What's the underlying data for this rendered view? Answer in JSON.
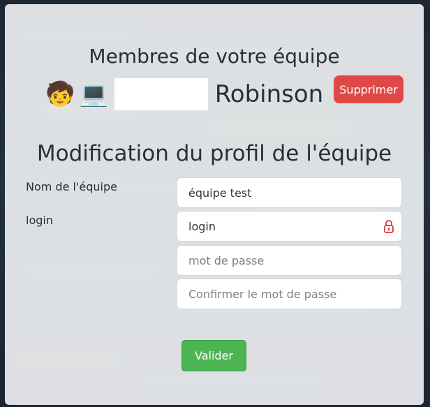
{
  "members_section": {
    "title": "Membres de votre équipe",
    "member": {
      "avatar_emoji": "🧒",
      "device_emoji": "💻",
      "last_name": "Robinson",
      "delete_label": "Supprimer"
    }
  },
  "profile_section": {
    "title": "Modification du profil de l'équipe",
    "team_name": {
      "label": "Nom de l'équipe",
      "value": "équipe test"
    },
    "login": {
      "label": "login",
      "value": "login"
    },
    "password": {
      "placeholder": "mot de passe"
    },
    "confirm_password": {
      "placeholder": "Confirmer le mot de passe"
    },
    "submit_label": "Valider"
  },
  "colors": {
    "delete": "#e04848",
    "submit": "#4cb552",
    "lock_icon": "#d9333f"
  }
}
